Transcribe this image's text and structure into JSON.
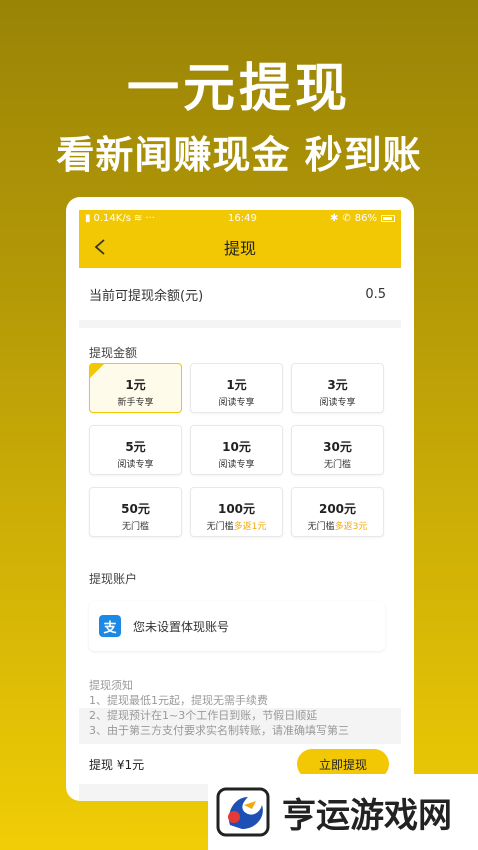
{
  "hero": {
    "title": "一元提现",
    "subtitle": "看新闻赚现金 秒到账"
  },
  "statusbar": {
    "network": "0.14K/s",
    "dots": "···",
    "time": "16:49",
    "battery": "86%"
  },
  "navbar": {
    "title": "提现"
  },
  "balance": {
    "label": "当前可提现余额(元)",
    "value": "0.5"
  },
  "amounts": {
    "label": "提现金额",
    "options": [
      {
        "value": "1元",
        "desc": "新手专享",
        "bonus": "",
        "selected": true
      },
      {
        "value": "1元",
        "desc": "阅读专享",
        "bonus": ""
      },
      {
        "value": "3元",
        "desc": "阅读专享",
        "bonus": ""
      },
      {
        "value": "5元",
        "desc": "阅读专享",
        "bonus": ""
      },
      {
        "value": "10元",
        "desc": "阅读专享",
        "bonus": ""
      },
      {
        "value": "30元",
        "desc": "无门槛",
        "bonus": ""
      },
      {
        "value": "50元",
        "desc": "无门槛",
        "bonus": ""
      },
      {
        "value": "100元",
        "desc": "无门槛",
        "bonus": "多返1元"
      },
      {
        "value": "200元",
        "desc": "无门槛",
        "bonus": "多返3元"
      }
    ]
  },
  "account": {
    "label": "提现账户",
    "text": "您未设置体现账号",
    "icon": "支"
  },
  "notice": {
    "title": "提现须知",
    "lines": [
      "1、提现最低1元起，提现无需手续费",
      "2、提现预计在1~3个工作日到账，节假日顺延",
      "3、由于第三方支付要求实名制转账，请准确填写第三"
    ]
  },
  "bottom": {
    "summary": "提现 ¥1元",
    "button": "立即提现"
  },
  "watermark": {
    "text": "亨运游戏网"
  },
  "colors": {
    "accent": "#f2c805",
    "bonus": "#f2a805"
  }
}
